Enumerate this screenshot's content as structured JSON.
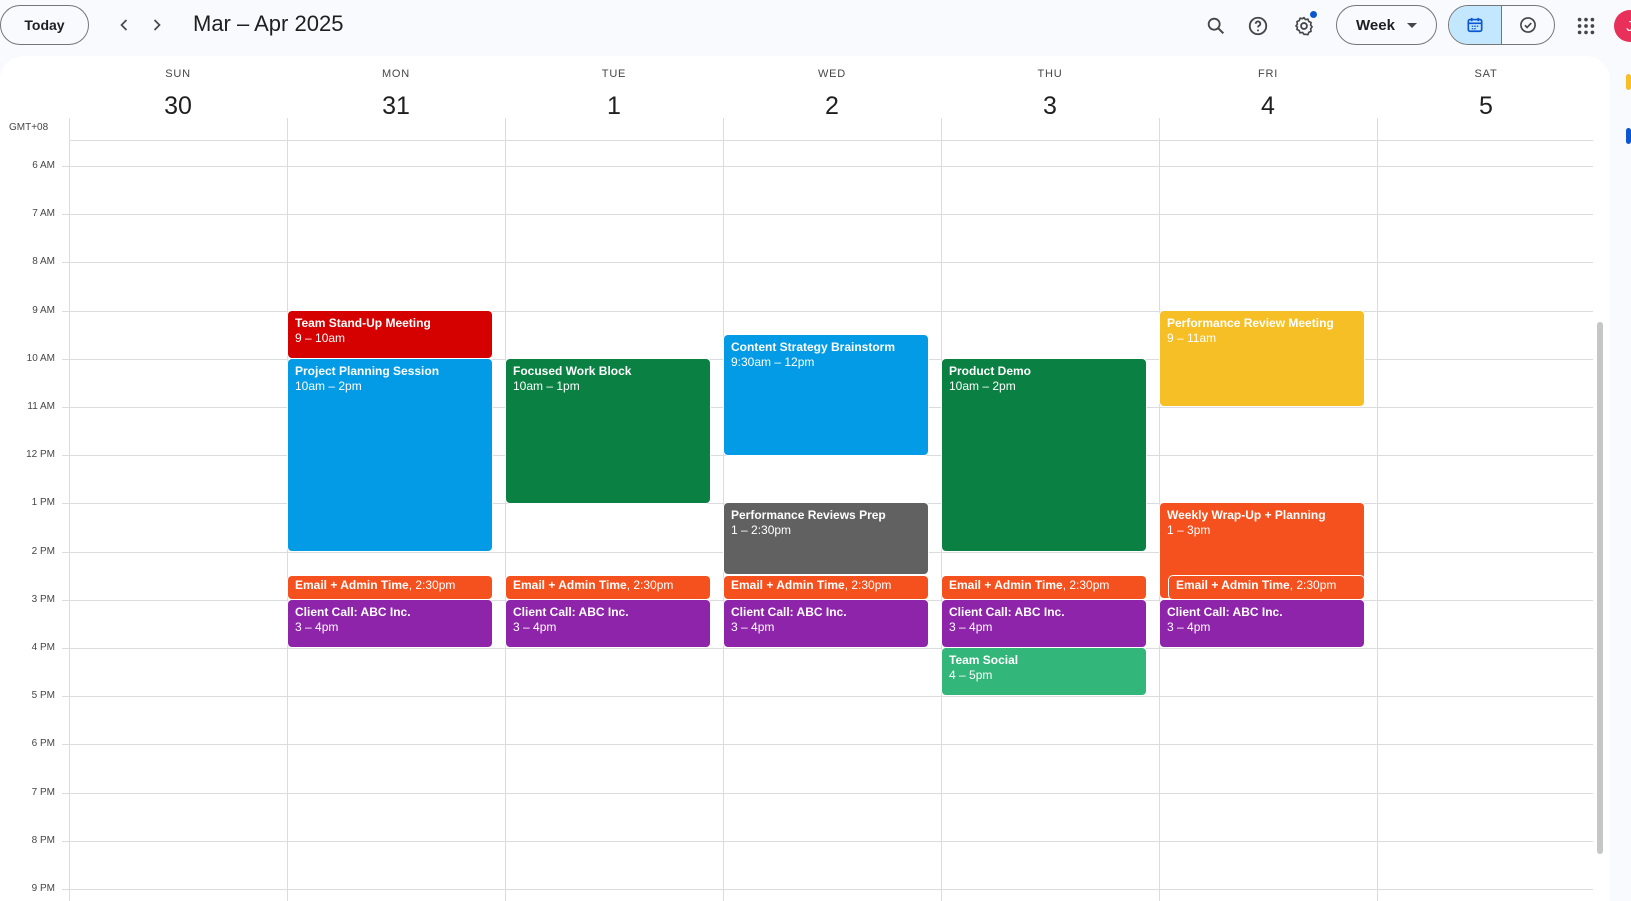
{
  "header": {
    "today_label": "Today",
    "range_title": "Mar – Apr 2025",
    "view_label": "Week",
    "avatar_initial": "J"
  },
  "timezone_label": "GMT+08",
  "days": [
    {
      "dow": "SUN",
      "num": "30"
    },
    {
      "dow": "MON",
      "num": "31"
    },
    {
      "dow": "TUE",
      "num": "1"
    },
    {
      "dow": "WED",
      "num": "2"
    },
    {
      "dow": "THU",
      "num": "3"
    },
    {
      "dow": "FRI",
      "num": "4"
    },
    {
      "dow": "SAT",
      "num": "5"
    }
  ],
  "hours": [
    "6 AM",
    "7 AM",
    "8 AM",
    "9 AM",
    "10 AM",
    "11 AM",
    "12 PM",
    "1 PM",
    "2 PM",
    "3 PM",
    "4 PM",
    "5 PM",
    "6 PM",
    "7 PM",
    "8 PM",
    "9 PM"
  ],
  "colors": {
    "red": "#d50000",
    "blue": "#039be5",
    "green": "#0b8043",
    "graphite": "#616161",
    "orange": "#f4511e",
    "purple": "#8e24aa",
    "sage": "#33b679",
    "yellow": "#f6bf26"
  },
  "events": [
    {
      "day": 1,
      "start": 9,
      "end": 10,
      "title": "Team Stand-Up Meeting",
      "time": "9 – 10am",
      "color": "red"
    },
    {
      "day": 1,
      "start": 10,
      "end": 14,
      "title": "Project Planning Session",
      "time": "10am – 2pm",
      "color": "blue"
    },
    {
      "day": 1,
      "start": 14.5,
      "end": 15,
      "title": "Email + Admin Time",
      "time": "2:30pm",
      "color": "orange",
      "slim": true
    },
    {
      "day": 1,
      "start": 15,
      "end": 16,
      "title": "Client Call: ABC Inc.",
      "time": "3 – 4pm",
      "color": "purple"
    },
    {
      "day": 2,
      "start": 10,
      "end": 13,
      "title": "Focused Work Block",
      "time": "10am – 1pm",
      "color": "green"
    },
    {
      "day": 2,
      "start": 14.5,
      "end": 15,
      "title": "Email + Admin Time",
      "time": "2:30pm",
      "color": "orange",
      "slim": true
    },
    {
      "day": 2,
      "start": 15,
      "end": 16,
      "title": "Client Call: ABC Inc.",
      "time": "3 – 4pm",
      "color": "purple"
    },
    {
      "day": 3,
      "start": 9.5,
      "end": 12,
      "title": "Content Strategy Brainstorm",
      "time": "9:30am – 12pm",
      "color": "blue"
    },
    {
      "day": 3,
      "start": 13,
      "end": 14.5,
      "title": "Performance Reviews Prep",
      "time": "1 – 2:30pm",
      "color": "graphite"
    },
    {
      "day": 3,
      "start": 14.5,
      "end": 15,
      "title": "Email + Admin Time",
      "time": "2:30pm",
      "color": "orange",
      "slim": true
    },
    {
      "day": 3,
      "start": 15,
      "end": 16,
      "title": "Client Call: ABC Inc.",
      "time": "3 – 4pm",
      "color": "purple"
    },
    {
      "day": 4,
      "start": 10,
      "end": 14,
      "title": "Product Demo",
      "time": "10am – 2pm",
      "color": "green"
    },
    {
      "day": 4,
      "start": 14.5,
      "end": 15,
      "title": "Email + Admin Time",
      "time": "2:30pm",
      "color": "orange",
      "slim": true
    },
    {
      "day": 4,
      "start": 15,
      "end": 16,
      "title": "Client Call: ABC Inc.",
      "time": "3 – 4pm",
      "color": "purple"
    },
    {
      "day": 4,
      "start": 16,
      "end": 17,
      "title": "Team Social",
      "time": "4 – 5pm",
      "color": "sage"
    },
    {
      "day": 5,
      "start": 9,
      "end": 11,
      "title": "Performance Review Meeting",
      "time": "9 – 11am",
      "color": "yellow"
    },
    {
      "day": 5,
      "start": 13,
      "end": 15,
      "title": "Weekly Wrap-Up + Planning",
      "time": "1 – 3pm",
      "color": "orange"
    },
    {
      "day": 5,
      "start": 14.5,
      "end": 15,
      "title": "Email + Admin Time",
      "time": "2:30pm",
      "color": "orange",
      "slim": true,
      "indent": true
    },
    {
      "day": 5,
      "start": 15,
      "end": 16,
      "title": "Client Call: ABC Inc.",
      "time": "3 – 4pm",
      "color": "purple"
    }
  ]
}
